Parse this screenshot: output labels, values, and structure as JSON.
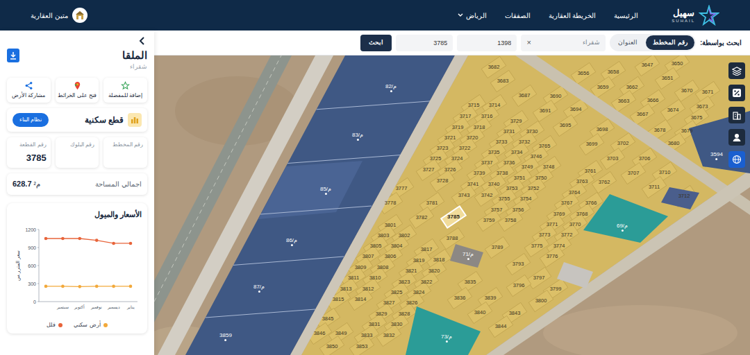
{
  "header": {
    "company": "متين العقارية",
    "brand": "سهيل",
    "brand_latin": "SUHAIL",
    "nav": [
      {
        "label": "الرئيسية",
        "kind": "link",
        "selected": false
      },
      {
        "label": "الخريطة العقارية",
        "kind": "link",
        "selected": false
      },
      {
        "label": "الصفقات",
        "kind": "link",
        "selected": false
      },
      {
        "label": "الرياض",
        "kind": "dropdown",
        "selected": false
      }
    ]
  },
  "search": {
    "label": "ابحث بواسطة:",
    "modes": [
      {
        "label": "رقم المخطط",
        "selected": true
      },
      {
        "label": "العنوان",
        "selected": false
      }
    ],
    "district": "شقراء",
    "clear": "×",
    "plan_value": "1398",
    "plot_value": "3785",
    "button": "ابحث"
  },
  "sidebar": {
    "title": "الملقا",
    "subtitle": "شقراء",
    "actions": [
      {
        "label": "إضافة للمفضلة"
      },
      {
        "label": "فتح على الخرائط"
      },
      {
        "label": "مشاركة الأرض"
      }
    ],
    "category": "قطع سكنية",
    "building_button": "نظام البناء",
    "fields": [
      {
        "label": "رقم المخطط",
        "value": ""
      },
      {
        "label": "رقم البلوك",
        "value": ""
      },
      {
        "label": "رقم القطعة",
        "value": "3785"
      }
    ],
    "area": {
      "label": "اجمالي المساحة",
      "value": "628.7",
      "unit": "م²"
    }
  },
  "chart": {
    "title": "الأسعار والميول",
    "y_axis_label": "سعر المتر ر.س",
    "y_ticks": [
      "0",
      "300",
      "600",
      "900",
      "1200"
    ],
    "x_labels": [
      "سبتمبر",
      "أكتوبر",
      "نوفمبر",
      "ديسمبر",
      "يناير"
    ],
    "series": [
      {
        "name": "أرض سكني",
        "color": "#f2a93b",
        "values": [
          255,
          255,
          250,
          255,
          255,
          255
        ]
      },
      {
        "name": "فلل",
        "color": "#e8643a",
        "values": [
          1050,
          1050,
          1050,
          1020,
          970,
          970
        ]
      }
    ]
  },
  "map": {
    "labels": [
      {
        "text": "82/م",
        "kind": "zone",
        "selected": false
      },
      {
        "text": "83/م",
        "kind": "zone",
        "selected": false
      },
      {
        "text": "85/م",
        "kind": "zone",
        "selected": false
      },
      {
        "text": "86/م",
        "kind": "zone",
        "selected": false
      },
      {
        "text": "87/م",
        "kind": "zone",
        "selected": false
      },
      {
        "text": "69/م",
        "kind": "zone",
        "selected": false
      },
      {
        "text": "71/م",
        "kind": "zone",
        "selected": false
      },
      {
        "text": "73/م",
        "kind": "zone",
        "selected": false
      },
      {
        "text": "3594",
        "kind": "zone",
        "selected": false
      },
      {
        "text": "3859",
        "kind": "zone",
        "selected": false
      },
      {
        "text": "3682",
        "kind": "plot",
        "selected": false
      },
      {
        "text": "3683",
        "kind": "plot",
        "selected": false
      },
      {
        "text": "3687",
        "kind": "plot",
        "selected": false
      },
      {
        "text": "3690",
        "kind": "plot",
        "selected": false
      },
      {
        "text": "3691",
        "kind": "plot",
        "selected": false
      },
      {
        "text": "3694",
        "kind": "plot",
        "selected": false
      },
      {
        "text": "3695",
        "kind": "plot",
        "selected": false
      },
      {
        "text": "3656",
        "kind": "plot",
        "selected": false
      },
      {
        "text": "3658",
        "kind": "plot",
        "selected": false
      },
      {
        "text": "3659",
        "kind": "plot",
        "selected": false
      },
      {
        "text": "3662",
        "kind": "plot",
        "selected": false
      },
      {
        "text": "3647",
        "kind": "plot",
        "selected": false
      },
      {
        "text": "3650",
        "kind": "plot",
        "selected": false
      },
      {
        "text": "3651",
        "kind": "plot",
        "selected": false
      },
      {
        "text": "3663",
        "kind": "plot",
        "selected": false
      },
      {
        "text": "3666",
        "kind": "plot",
        "selected": false
      },
      {
        "text": "3667",
        "kind": "plot",
        "selected": false
      },
      {
        "text": "3670",
        "kind": "plot",
        "selected": false
      },
      {
        "text": "3671",
        "kind": "plot",
        "selected": false
      },
      {
        "text": "3673",
        "kind": "plot",
        "selected": false
      },
      {
        "text": "3674",
        "kind": "plot",
        "selected": false
      },
      {
        "text": "3675",
        "kind": "plot",
        "selected": false
      },
      {
        "text": "3678",
        "kind": "plot",
        "selected": false
      },
      {
        "text": "3679",
        "kind": "plot",
        "selected": false
      },
      {
        "text": "3680",
        "kind": "plot",
        "selected": false
      },
      {
        "text": "3698",
        "kind": "plot",
        "selected": false
      },
      {
        "text": "3699",
        "kind": "plot",
        "selected": false
      },
      {
        "text": "3702",
        "kind": "plot",
        "selected": false
      },
      {
        "text": "3703",
        "kind": "plot",
        "selected": false
      },
      {
        "text": "3706",
        "kind": "plot",
        "selected": false
      },
      {
        "text": "3707",
        "kind": "plot",
        "selected": false
      },
      {
        "text": "3710",
        "kind": "plot",
        "selected": false
      },
      {
        "text": "3711",
        "kind": "plot",
        "selected": false
      },
      {
        "text": "3712",
        "kind": "plot",
        "selected": false
      },
      {
        "text": "3715",
        "kind": "plot",
        "selected": false
      },
      {
        "text": "3714",
        "kind": "plot",
        "selected": false
      },
      {
        "text": "3717",
        "kind": "plot",
        "selected": false
      },
      {
        "text": "3716",
        "kind": "plot",
        "selected": false
      },
      {
        "text": "3719",
        "kind": "plot",
        "selected": false
      },
      {
        "text": "3718",
        "kind": "plot",
        "selected": false
      },
      {
        "text": "3721",
        "kind": "plot",
        "selected": false
      },
      {
        "text": "3720",
        "kind": "plot",
        "selected": false
      },
      {
        "text": "3723",
        "kind": "plot",
        "selected": false
      },
      {
        "text": "3722",
        "kind": "plot",
        "selected": false
      },
      {
        "text": "3725",
        "kind": "plot",
        "selected": false
      },
      {
        "text": "3724",
        "kind": "plot",
        "selected": false
      },
      {
        "text": "3727",
        "kind": "plot",
        "selected": false
      },
      {
        "text": "3726",
        "kind": "plot",
        "selected": false
      },
      {
        "text": "3728",
        "kind": "plot",
        "selected": false
      },
      {
        "text": "3729",
        "kind": "plot",
        "selected": false
      },
      {
        "text": "3731",
        "kind": "plot",
        "selected": false
      },
      {
        "text": "3730",
        "kind": "plot",
        "selected": false
      },
      {
        "text": "3733",
        "kind": "plot",
        "selected": false
      },
      {
        "text": "3732",
        "kind": "plot",
        "selected": false
      },
      {
        "text": "3735",
        "kind": "plot",
        "selected": false
      },
      {
        "text": "3734",
        "kind": "plot",
        "selected": false
      },
      {
        "text": "3737",
        "kind": "plot",
        "selected": false
      },
      {
        "text": "3736",
        "kind": "plot",
        "selected": false
      },
      {
        "text": "3739",
        "kind": "plot",
        "selected": false
      },
      {
        "text": "3738",
        "kind": "plot",
        "selected": false
      },
      {
        "text": "3741",
        "kind": "plot",
        "selected": false
      },
      {
        "text": "3740",
        "kind": "plot",
        "selected": false
      },
      {
        "text": "3743",
        "kind": "plot",
        "selected": false
      },
      {
        "text": "3742",
        "kind": "plot",
        "selected": false
      },
      {
        "text": "3777",
        "kind": "plot",
        "selected": false
      },
      {
        "text": "3778",
        "kind": "plot",
        "selected": false
      },
      {
        "text": "3781",
        "kind": "plot",
        "selected": false
      },
      {
        "text": "3782",
        "kind": "plot",
        "selected": false
      },
      {
        "text": "3785",
        "kind": "plot",
        "selected": true
      },
      {
        "text": "3788",
        "kind": "plot",
        "selected": false
      },
      {
        "text": "3801",
        "kind": "plot",
        "selected": false
      },
      {
        "text": "3803",
        "kind": "plot",
        "selected": false
      },
      {
        "text": "3802",
        "kind": "plot",
        "selected": false
      },
      {
        "text": "3805",
        "kind": "plot",
        "selected": false
      },
      {
        "text": "3804",
        "kind": "plot",
        "selected": false
      },
      {
        "text": "3807",
        "kind": "plot",
        "selected": false
      },
      {
        "text": "3806",
        "kind": "plot",
        "selected": false
      },
      {
        "text": "3809",
        "kind": "plot",
        "selected": false
      },
      {
        "text": "3808",
        "kind": "plot",
        "selected": false
      },
      {
        "text": "3811",
        "kind": "plot",
        "selected": false
      },
      {
        "text": "3810",
        "kind": "plot",
        "selected": false
      },
      {
        "text": "3813",
        "kind": "plot",
        "selected": false
      },
      {
        "text": "3812",
        "kind": "plot",
        "selected": false
      },
      {
        "text": "3815",
        "kind": "plot",
        "selected": false
      },
      {
        "text": "3814",
        "kind": "plot",
        "selected": false
      },
      {
        "text": "3817",
        "kind": "plot",
        "selected": false
      },
      {
        "text": "3818",
        "kind": "plot",
        "selected": false
      },
      {
        "text": "3819",
        "kind": "plot",
        "selected": false
      },
      {
        "text": "3821",
        "kind": "plot",
        "selected": false
      },
      {
        "text": "3820",
        "kind": "plot",
        "selected": false
      },
      {
        "text": "3823",
        "kind": "plot",
        "selected": false
      },
      {
        "text": "3822",
        "kind": "plot",
        "selected": false
      },
      {
        "text": "3825",
        "kind": "plot",
        "selected": false
      },
      {
        "text": "3824",
        "kind": "plot",
        "selected": false
      },
      {
        "text": "3827",
        "kind": "plot",
        "selected": false
      },
      {
        "text": "3826",
        "kind": "plot",
        "selected": false
      },
      {
        "text": "3829",
        "kind": "plot",
        "selected": false
      },
      {
        "text": "3828",
        "kind": "plot",
        "selected": false
      },
      {
        "text": "3831",
        "kind": "plot",
        "selected": false
      },
      {
        "text": "3830",
        "kind": "plot",
        "selected": false
      },
      {
        "text": "3833",
        "kind": "plot",
        "selected": false
      },
      {
        "text": "3832",
        "kind": "plot",
        "selected": false
      },
      {
        "text": "3789",
        "kind": "plot",
        "selected": false
      },
      {
        "text": "3793",
        "kind": "plot",
        "selected": false
      },
      {
        "text": "3797",
        "kind": "plot",
        "selected": false
      },
      {
        "text": "3796",
        "kind": "plot",
        "selected": false
      },
      {
        "text": "3799",
        "kind": "plot",
        "selected": false
      },
      {
        "text": "3800",
        "kind": "plot",
        "selected": false
      },
      {
        "text": "3835",
        "kind": "plot",
        "selected": false
      },
      {
        "text": "3836",
        "kind": "plot",
        "selected": false
      },
      {
        "text": "3839",
        "kind": "plot",
        "selected": false
      },
      {
        "text": "3840",
        "kind": "plot",
        "selected": false
      },
      {
        "text": "3843",
        "kind": "plot",
        "selected": false
      },
      {
        "text": "3844",
        "kind": "plot",
        "selected": false
      },
      {
        "text": "3845",
        "kind": "plot",
        "selected": false
      },
      {
        "text": "3846",
        "kind": "plot",
        "selected": false
      },
      {
        "text": "3849",
        "kind": "plot",
        "selected": false
      },
      {
        "text": "3850",
        "kind": "plot",
        "selected": false
      },
      {
        "text": "3853",
        "kind": "plot",
        "selected": false
      },
      {
        "text": "3765",
        "kind": "plot",
        "selected": false
      },
      {
        "text": "3746",
        "kind": "plot",
        "selected": false
      },
      {
        "text": "3749",
        "kind": "plot",
        "selected": false
      },
      {
        "text": "3748",
        "kind": "plot",
        "selected": false
      },
      {
        "text": "3751",
        "kind": "plot",
        "selected": false
      },
      {
        "text": "3750",
        "kind": "plot",
        "selected": false
      },
      {
        "text": "3753",
        "kind": "plot",
        "selected": false
      },
      {
        "text": "3752",
        "kind": "plot",
        "selected": false
      },
      {
        "text": "3755",
        "kind": "plot",
        "selected": false
      },
      {
        "text": "3754",
        "kind": "plot",
        "selected": false
      },
      {
        "text": "3757",
        "kind": "plot",
        "selected": false
      },
      {
        "text": "3756",
        "kind": "plot",
        "selected": false
      },
      {
        "text": "3759",
        "kind": "plot",
        "selected": false
      },
      {
        "text": "3758",
        "kind": "plot",
        "selected": false
      },
      {
        "text": "3761",
        "kind": "plot",
        "selected": false
      },
      {
        "text": "3763",
        "kind": "plot",
        "selected": false
      },
      {
        "text": "3762",
        "kind": "plot",
        "selected": false
      },
      {
        "text": "3764",
        "kind": "plot",
        "selected": false
      },
      {
        "text": "3767",
        "kind": "plot",
        "selected": false
      },
      {
        "text": "3766",
        "kind": "plot",
        "selected": false
      },
      {
        "text": "3769",
        "kind": "plot",
        "selected": false
      },
      {
        "text": "3768",
        "kind": "plot",
        "selected": false
      },
      {
        "text": "3771",
        "kind": "plot",
        "selected": false
      },
      {
        "text": "3770",
        "kind": "plot",
        "selected": false
      },
      {
        "text": "3773",
        "kind": "plot",
        "selected": false
      },
      {
        "text": "3772",
        "kind": "plot",
        "selected": false
      },
      {
        "text": "3775",
        "kind": "plot",
        "selected": false
      },
      {
        "text": "3774",
        "kind": "plot",
        "selected": false
      },
      {
        "text": "3776",
        "kind": "plot",
        "selected": false
      }
    ]
  }
}
